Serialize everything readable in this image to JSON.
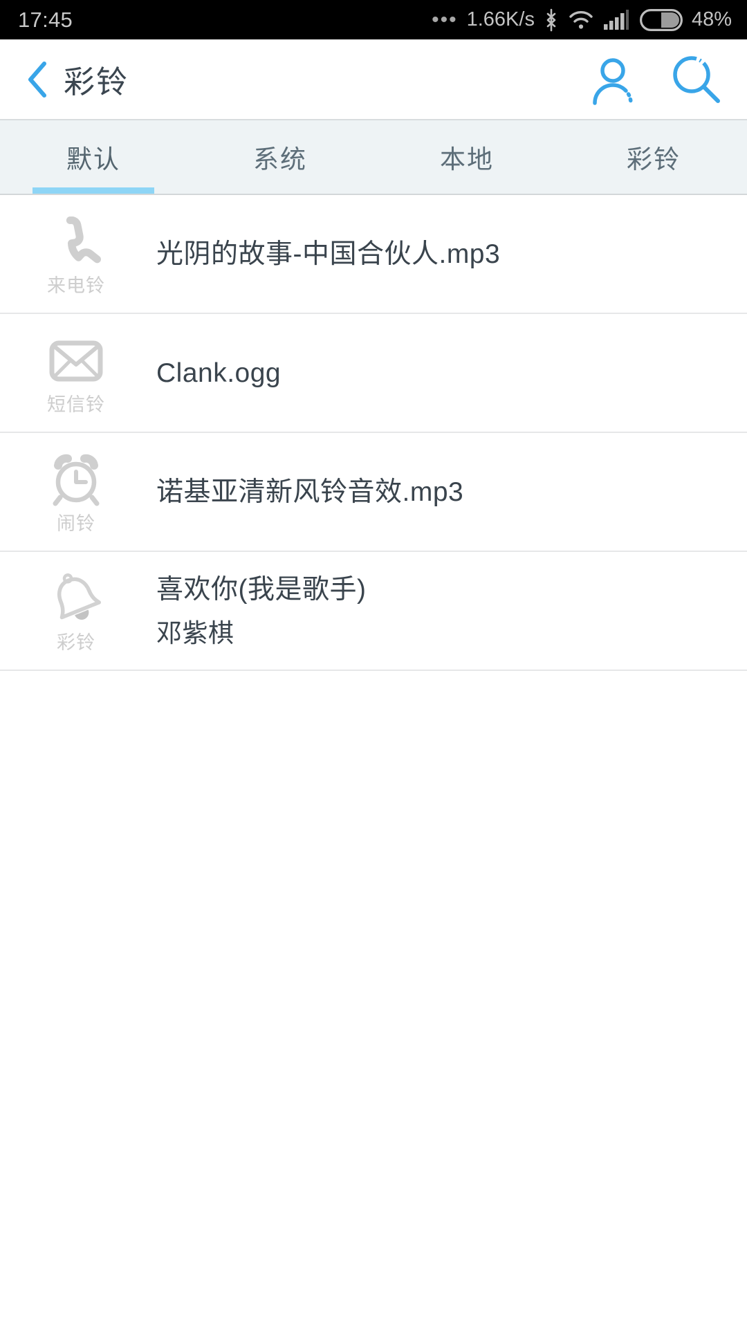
{
  "status_bar": {
    "time": "17:45",
    "dots": "•••",
    "net_speed": "1.66K/s",
    "bluetooth_icon": "bluetooth-icon",
    "wifi_icon": "wifi-icon",
    "signal_icon": "signal-bars-icon",
    "battery_icon": "battery-icon",
    "battery_percent": "48%"
  },
  "app_bar": {
    "back_icon": "back-chevron-icon",
    "title": "彩铃",
    "account_icon": "person-icon",
    "search_icon": "search-icon",
    "accent_color": "#39a5e8"
  },
  "tabs": {
    "active_index": 0,
    "indicator_color": "#8ed5f6",
    "items": [
      {
        "label": "默认"
      },
      {
        "label": "系统"
      },
      {
        "label": "本地"
      },
      {
        "label": "彩铃"
      }
    ]
  },
  "list": {
    "rows": [
      {
        "icon": "phone-handset-icon",
        "icon_caption": "来电铃",
        "title": "光阴的故事-中国合伙人.mp3",
        "subtitle": ""
      },
      {
        "icon": "envelope-icon",
        "icon_caption": "短信铃",
        "title": "Clank.ogg",
        "subtitle": ""
      },
      {
        "icon": "alarm-clock-icon",
        "icon_caption": "闹铃",
        "title": "诺基亚清新风铃音效.mp3",
        "subtitle": ""
      },
      {
        "icon": "bell-icon",
        "icon_caption": "彩铃",
        "title": "喜欢你(我是歌手)",
        "subtitle": "邓紫棋"
      }
    ]
  }
}
